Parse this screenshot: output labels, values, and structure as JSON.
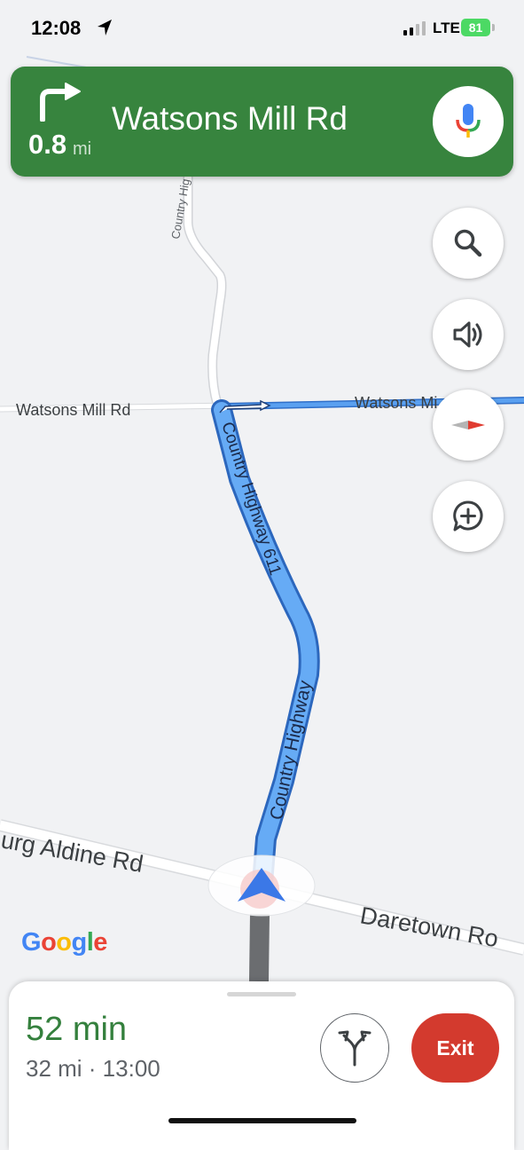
{
  "status_bar": {
    "time": "12:08",
    "network": "LTE",
    "battery": "81"
  },
  "nav": {
    "maneuver_icon": "turn-right-icon",
    "distance_value": "0.8",
    "distance_unit": "mi",
    "street": "Watsons Mill Rd",
    "mic_icon": "mic-icon"
  },
  "map": {
    "labels": {
      "watsons_left": "Watsons Mill Rd",
      "watsons_right": "Watsons Mi",
      "country_top": "Country Hig",
      "hwy_upper": "Country Highway 611",
      "hwy_lower": "Country Highway",
      "aldine": "urg Aldine Rd",
      "daretown": "Daretown Ro"
    },
    "route_color": "#4a90e8"
  },
  "fab_buttons": [
    "search-icon",
    "volume-icon",
    "compass-icon",
    "add-report-icon"
  ],
  "logo": {
    "letters": [
      "G",
      "o",
      "o",
      "g",
      "l",
      "e"
    ]
  },
  "trip": {
    "duration": "52 min",
    "details": "32 mi · 13:00",
    "exit_label": "Exit"
  },
  "colors": {
    "banner": "#37843e",
    "eta": "#34803d",
    "exit": "#d33a2e"
  }
}
